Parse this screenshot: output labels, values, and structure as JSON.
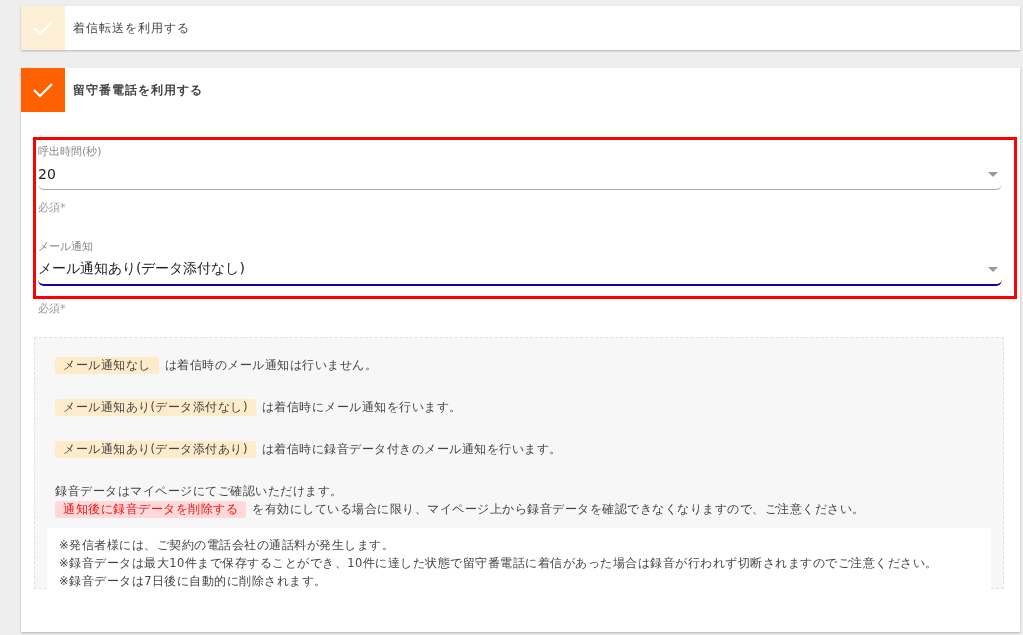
{
  "options": [
    {
      "label": "着信転送を利用する",
      "checked": false
    },
    {
      "label": "留守番電話を利用する",
      "checked": true
    }
  ],
  "fields": [
    {
      "label": "呼出時間(秒)",
      "value": "20",
      "hint": "必須*",
      "focused": false
    },
    {
      "label": "メール通知",
      "value": "メール通知あり(データ添付なし)",
      "hint": "必須*",
      "focused": true
    }
  ],
  "info": {
    "items": [
      {
        "tag": "メール通知なし",
        "text": "は着信時のメール通知は行いません。"
      },
      {
        "tag": "メール通知あり(データ添付なし)",
        "text": "は着信時にメール通知を行います。"
      },
      {
        "tag": "メール通知あり(データ添付あり)",
        "text": "は着信時に録音データ付きのメール通知を行います。"
      }
    ],
    "record_line": "録音データはマイページにてご確認いただけます。",
    "warning_tag": "通知後に録音データを削除する",
    "warning_text": "を有効にしている場合に限り、マイページ上から録音データを確認できなくなりますので、ご注意ください。",
    "notes": [
      "※発信者様には、ご契約の電話会社の通話料が発生します。",
      "※録音データは最大10件まで保存することができ、10件に達した状態で留守番電話に着信があった場合は録音が行われず切断されますのでご注意ください。",
      "※録音データは7日後に自動的に削除されます。"
    ]
  }
}
